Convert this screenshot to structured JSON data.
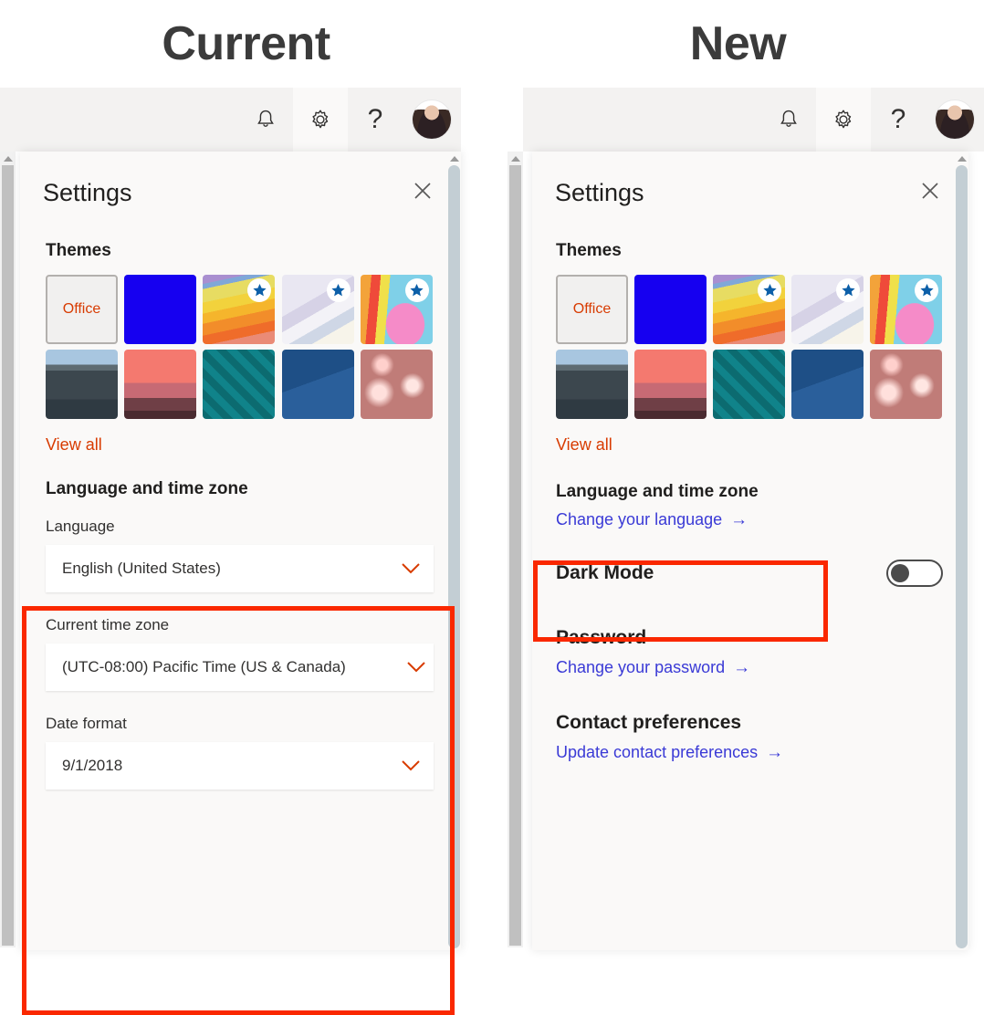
{
  "columns": [
    {
      "title": "Current"
    },
    {
      "title": "New"
    }
  ],
  "header": {
    "bell_icon": "bell-icon",
    "gear_icon": "gear-icon",
    "help_icon": "help-icon",
    "help_glyph": "?",
    "avatar_icon": "user-avatar"
  },
  "flyout": {
    "title": "Settings",
    "close_glyph": "✕",
    "themes_label": "Themes",
    "office_tile_label": "Office",
    "view_all_label": "View all",
    "themes": [
      {
        "name": "office",
        "premium": false
      },
      {
        "name": "blue",
        "premium": false
      },
      {
        "name": "rainbow-stripes",
        "premium": true
      },
      {
        "name": "white-ribbons",
        "premium": true
      },
      {
        "name": "unicorn",
        "premium": true
      },
      {
        "name": "mountain-road",
        "premium": false
      },
      {
        "name": "palm-sunset",
        "premium": false
      },
      {
        "name": "circuit-board",
        "premium": false
      },
      {
        "name": "blueprint-elevation",
        "premium": false
      },
      {
        "name": "red-lights",
        "premium": false
      }
    ]
  },
  "current_panel": {
    "section_title": "Language and time zone",
    "fields": [
      {
        "label": "Language",
        "value": "English (United States)"
      },
      {
        "label": "Current time zone",
        "value": "(UTC-08:00) Pacific Time (US & Canada)"
      },
      {
        "label": "Date format",
        "value": "9/1/2018"
      }
    ],
    "chevron_glyph": "⌄"
  },
  "new_panel": {
    "sections": [
      {
        "heading": "Language and time zone",
        "link": "Change your language",
        "arrow": "→"
      },
      {
        "heading": "Dark Mode",
        "toggle": true,
        "toggle_state": "off"
      },
      {
        "heading": "Password",
        "link": "Change your password",
        "arrow": "→"
      },
      {
        "heading": "Contact preferences",
        "link": "Update contact preferences",
        "arrow": "→"
      }
    ]
  },
  "accent_colors": {
    "office_orange": "#d83b01",
    "link_blue": "#3a3ad6",
    "annotation_red": "#fa2800",
    "panel_bg": "#faf9f8",
    "chrome_bg": "#f3f2f1"
  }
}
